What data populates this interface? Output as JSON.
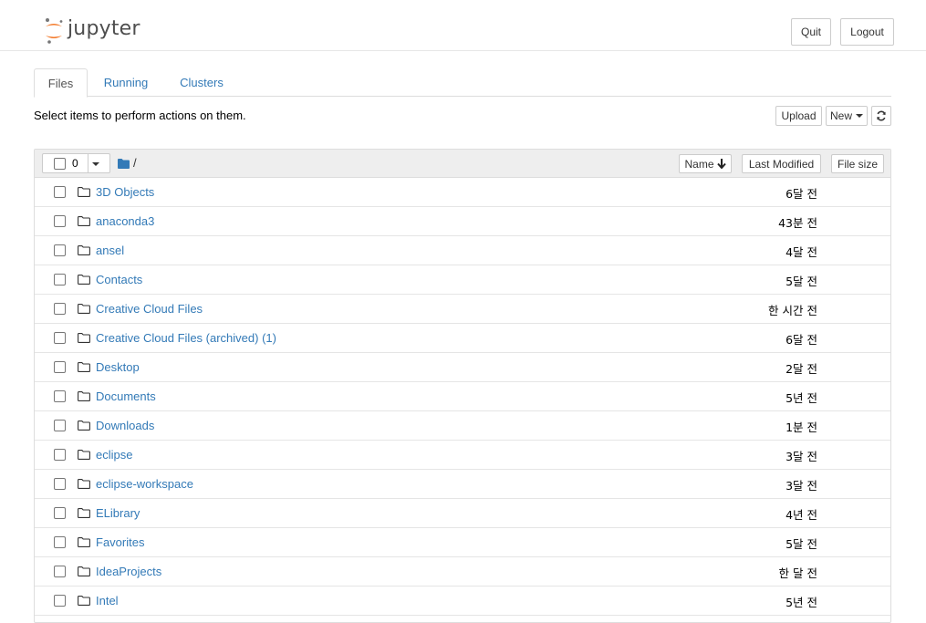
{
  "header": {
    "logo_text": "jupyter",
    "quit_label": "Quit",
    "logout_label": "Logout"
  },
  "tabs": [
    {
      "label": "Files",
      "active": true
    },
    {
      "label": "Running",
      "active": false
    },
    {
      "label": "Clusters",
      "active": false
    }
  ],
  "toolbar": {
    "hint": "Select items to perform actions on them.",
    "upload_label": "Upload",
    "new_label": "New"
  },
  "list_header": {
    "selected_count": "0",
    "path": "/",
    "sort_name_label": "Name",
    "last_modified_label": "Last Modified",
    "file_size_label": "File size"
  },
  "rows": [
    {
      "name": "3D Objects",
      "modified": "6달 전"
    },
    {
      "name": "anaconda3",
      "modified": "43분 전"
    },
    {
      "name": "ansel",
      "modified": "4달 전"
    },
    {
      "name": "Contacts",
      "modified": "5달 전"
    },
    {
      "name": "Creative Cloud Files",
      "modified": "한 시간 전"
    },
    {
      "name": "Creative Cloud Files (archived) (1)",
      "modified": "6달 전"
    },
    {
      "name": "Desktop",
      "modified": "2달 전"
    },
    {
      "name": "Documents",
      "modified": "5년 전"
    },
    {
      "name": "Downloads",
      "modified": "1분 전"
    },
    {
      "name": "eclipse",
      "modified": "3달 전"
    },
    {
      "name": "eclipse-workspace",
      "modified": "3달 전"
    },
    {
      "name": "ELibrary",
      "modified": "4년 전"
    },
    {
      "name": "Favorites",
      "modified": "5달 전"
    },
    {
      "name": "IdeaProjects",
      "modified": "한 달 전"
    },
    {
      "name": "Intel",
      "modified": "5년 전"
    }
  ],
  "colors": {
    "link": "#337ab7",
    "logo_orange": "#f37726",
    "logo_gray": "#767677"
  }
}
